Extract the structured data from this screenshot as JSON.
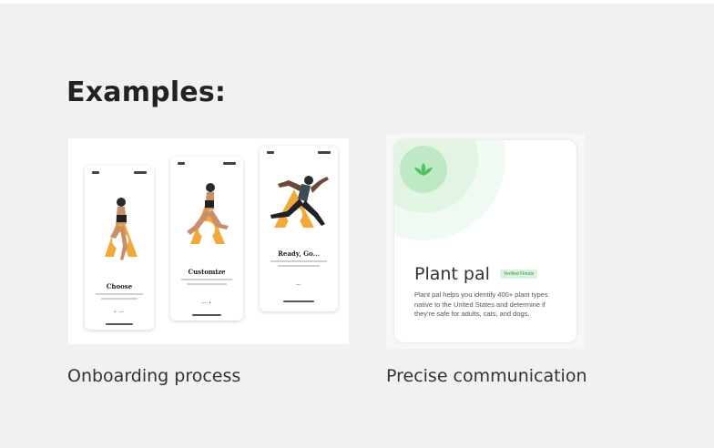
{
  "section": {
    "heading": "Examples:"
  },
  "examples": [
    {
      "caption": "Onboarding process",
      "screens": [
        {
          "title": "Choose"
        },
        {
          "title": "Customize"
        },
        {
          "title": "Ready, Go..."
        }
      ]
    },
    {
      "caption": "Precise communication",
      "app": {
        "name": "Plant pal",
        "badge": "Verified Florals",
        "description": "Plant pal helps you identify 400+ plant types native to the United States and determine if they're safe for adults, cats, and dogs."
      }
    }
  ],
  "colors": {
    "background": "#f1f1f1",
    "brand_yellow": "#f2a93b",
    "plant_green": "#4fc25a",
    "plant_ring": "#e7f7e8"
  },
  "icons": {
    "plant": "leaf-sprout-icon"
  }
}
